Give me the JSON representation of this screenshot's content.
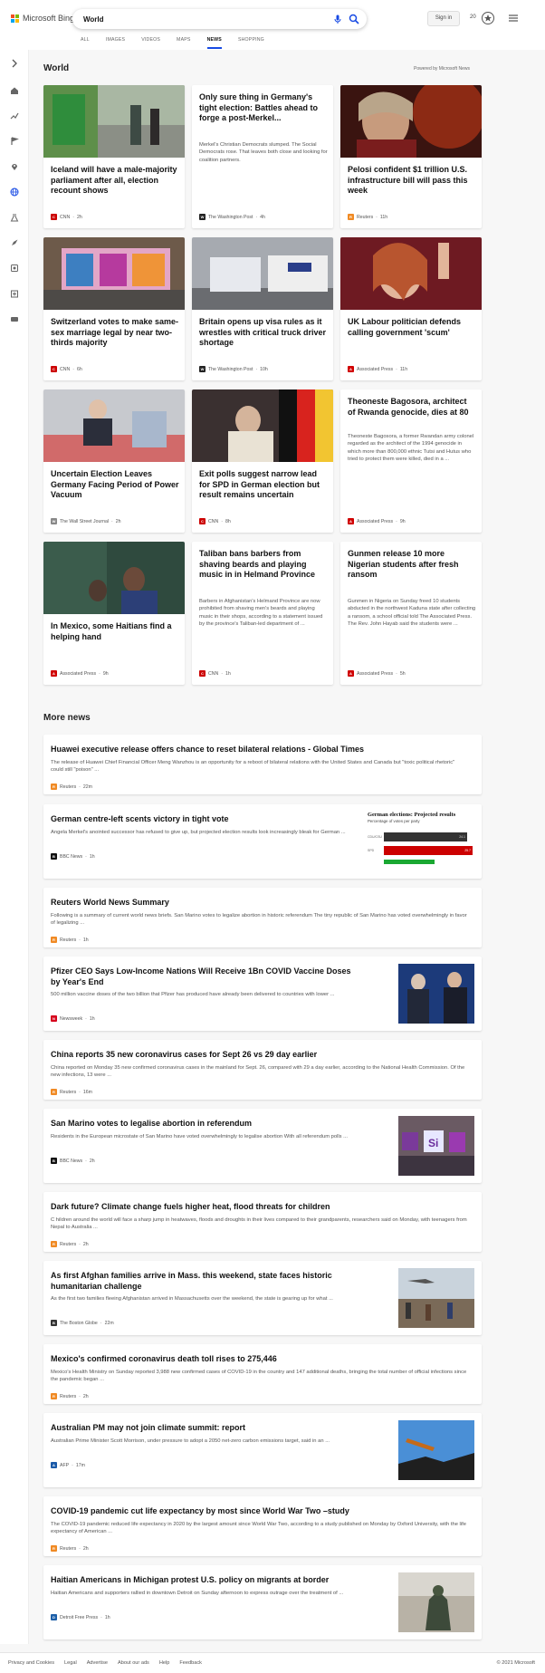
{
  "header": {
    "brand": "Microsoft Bing",
    "query": "World",
    "signin_label": "Sign in",
    "rewards_count": "20",
    "tabs": [
      "ALL",
      "IMAGES",
      "VIDEOS",
      "MAPS",
      "NEWS",
      "SHOPPING"
    ],
    "active_tab": "NEWS"
  },
  "section": {
    "title": "World",
    "powered_by": "Powered by Microsoft News"
  },
  "cards": [
    {
      "title": "Iceland will have a male-majority parliament after all, election recount shows",
      "snippet": "",
      "source": "CNN",
      "age": "2h",
      "src_color": "#cc0000"
    },
    {
      "title": "Only sure thing in Germany's tight election: Battles ahead to forge a post-Merkel...",
      "snippet": "Merkel's Christian Democrats slumped. The Social Democrats rose. That leaves both close and looking for coalition partners.",
      "source": "The Washington Post",
      "age": "4h",
      "src_color": "#222222"
    },
    {
      "title": "Pelosi confident $1 trillion U.S. infrastructure bill will pass this week",
      "snippet": "",
      "source": "Reuters",
      "age": "11h",
      "src_color": "#f08a24"
    },
    {
      "title": "Switzerland votes to make same-sex marriage legal by near two-thirds majority",
      "snippet": "",
      "source": "CNN",
      "age": "6h",
      "src_color": "#cc0000"
    },
    {
      "title": "Britain opens up visa rules as it wrestles with critical truck driver shortage",
      "snippet": "",
      "source": "The Washington Post",
      "age": "10h",
      "src_color": "#222222"
    },
    {
      "title": "UK Labour politician defends calling government 'scum'",
      "snippet": "",
      "source": "Associated Press",
      "age": "11h",
      "src_color": "#d00000"
    },
    {
      "title": "Uncertain Election Leaves Germany Facing Period of Power Vacuum",
      "snippet": "",
      "source": "The Wall Street Journal",
      "age": "2h",
      "src_color": "#555555"
    },
    {
      "title": "Exit polls suggest narrow lead for SPD in German election but result remains uncertain",
      "snippet": "",
      "source": "CNN",
      "age": "8h",
      "src_color": "#cc0000"
    },
    {
      "title": "Theoneste Bagosora, architect of Rwanda genocide, dies at 80",
      "snippet": "Theoneste Bagosora, a former Rwandan army colonel regarded as the architect of the 1994 genocide in which more than 800,000 ethnic Tutsi and Hutus who tried to protect them were killed, died in a ...",
      "source": "Associated Press",
      "age": "9h",
      "src_color": "#d00000"
    },
    {
      "title": "In Mexico, some Haitians find a helping hand",
      "snippet": "",
      "source": "Associated Press",
      "age": "9h",
      "src_color": "#d00000"
    },
    {
      "title": "Taliban bans barbers from shaving beards and playing music in in Helmand Province",
      "snippet": "Barbers in Afghanistan's Helmand Province are now prohibited from shaving men's beards and playing music in their shops, according to a statement issued by the province's Taliban-led department of ...",
      "source": "CNN",
      "age": "1h",
      "src_color": "#cc0000"
    },
    {
      "title": "Gunmen release 10 more Nigerian students after fresh ransom",
      "snippet": "Gunmen in Nigeria on Sunday freed 10 students abducted in the northwest Kaduna state after collecting a ransom, a school official told The Associated Press. The Rev. John Hayab said the students were ...",
      "source": "Associated Press",
      "age": "5h",
      "src_color": "#d00000"
    }
  ],
  "more_news": {
    "title": "More news",
    "items": [
      {
        "title": "Huawei executive release offers chance to reset bilateral relations - Global Times",
        "snippet": "The release of Huawei Chief Financial Officer Meng Wanzhou is an opportunity for a reboot of bilateral relations with the United States and Canada but \"toxic political rhetoric\" could still \"poison\" ...",
        "source": "Reuters",
        "age": "22m",
        "src_color": "#f08a24"
      },
      {
        "title": "German centre-left scents victory in tight vote",
        "snippet": "Angela Merkel's anointed successor has refused to give up, but projected election results look increasingly bleak for German ...",
        "source": "BBC News",
        "age": "1h",
        "src_color": "#111111"
      },
      {
        "title": "Reuters World News Summary",
        "snippet": "Following is a summary of current world news briefs. San Marino votes to legalize abortion in historic referendum The tiny republic of San Marino has voted overwhelmingly in favor of legalizing ...",
        "source": "Reuters",
        "age": "1h",
        "src_color": "#f08a24"
      },
      {
        "title": "Pfizer CEO Says Low-Income Nations Will Receive 1Bn COVID Vaccine Doses by Year's End",
        "snippet": "500 million vaccine doses of the two billion that Pfizer has produced have already been delivered to countries with lower ...",
        "source": "Newsweek",
        "age": "1h",
        "src_color": "#d6001c"
      },
      {
        "title": "China reports 35 new coronavirus cases for Sept 26 vs 29 day earlier",
        "snippet": "China reported on Monday 35 new confirmed coronavirus cases in the mainland for Sept. 26, compared with 29 a day earlier, according to the National Health Commission. Of the new infections, 13 were ...",
        "source": "Reuters",
        "age": "16m",
        "src_color": "#f08a24"
      },
      {
        "title": "San Marino votes to legalise abortion in referendum",
        "snippet": "Residents in the European microstate of San Marino have voted overwhelmingly to legalise abortion With all referendum polls ...",
        "source": "BBC News",
        "age": "2h",
        "src_color": "#111111"
      },
      {
        "title": "Dark future? Climate change fuels higher heat, flood threats for children",
        "snippet": "C hildren around the world will face a sharp jump in heatwaves, floods and droughts in their lives compared to their grandparents, researchers said on Monday, with teenagers from Nepal to Australia ...",
        "source": "Reuters",
        "age": "2h",
        "src_color": "#f08a24"
      },
      {
        "title": "As first Afghan families arrive in Mass. this weekend, state faces historic humanitarian challenge",
        "snippet": "As the first two families fleeing Afghanistan arrived in Massachusetts over the weekend, the state is gearing up for what ...",
        "source": "The Boston Globe",
        "age": "22m",
        "src_color": "#333333"
      },
      {
        "title": "Mexico's confirmed coronavirus death toll rises to 275,446",
        "snippet": "Mexico's Health Ministry on Sunday reported 3,988 new confirmed cases of COVID-19 in the country and 147 additional deaths, bringing the total number of official infections since the pandemic began ...",
        "source": "Reuters",
        "age": "2h",
        "src_color": "#f08a24"
      },
      {
        "title": "Australian PM may not join climate summit: report",
        "snippet": "Australian Prime Minister Scott Morrison, under pressure to adopt a 2050 net-zero carbon emissions target, said in an ...",
        "source": "AFP",
        "age": "17m",
        "src_color": "#1a5aa8"
      },
      {
        "title": "COVID-19 pandemic cut life expectancy by most since World War Two –study",
        "snippet": "The COVID-19 pandemic reduced life expectancy in 2020 by the largest amount since World War Two, according to a study published on Monday by Oxford University, with the life expectancy of American ...",
        "source": "Reuters",
        "age": "2h",
        "src_color": "#f08a24"
      },
      {
        "title": "Haitian Americans in Michigan protest U.S. policy on migrants at border",
        "snippet": "Haitian Americans and supporters rallied in downtown Detroit on Sunday afternoon to express outrage over the treatment of ...",
        "source": "Detroit Free Press",
        "age": "1h",
        "src_color": "#1d5fa8"
      }
    ]
  },
  "german_chart": {
    "title": "German elections: Projected results",
    "subtitle": "Percentage of votes per party",
    "rows": [
      {
        "label": "CDU/CSU",
        "value": "24.1",
        "color": "#333333",
        "pct": 0.241
      },
      {
        "label": "SPD",
        "value": "25.7",
        "color": "#cc0000",
        "pct": 0.257
      },
      {
        "label": "",
        "value": "",
        "color": "#1aa832",
        "pct": 0.148
      }
    ]
  },
  "san_marino_sign": "Si",
  "footer": {
    "links": [
      "Privacy and Cookies",
      "Legal",
      "Advertise",
      "About our ads",
      "Help",
      "Feedback"
    ],
    "copyright": "© 2021 Microsoft"
  },
  "icons": {
    "rail": [
      "expand-icon",
      "home-icon",
      "trending-icon",
      "flag-icon",
      "location-icon",
      "globe-icon",
      "science-icon",
      "rocket-icon",
      "entertainment-icon",
      "health-icon",
      "sports-icon"
    ]
  },
  "colors": {
    "accent": "#174ae4",
    "brand_red": "#f25022",
    "brand_green": "#7fba00",
    "brand_blue": "#00a4ef",
    "brand_yellow": "#ffb900"
  }
}
